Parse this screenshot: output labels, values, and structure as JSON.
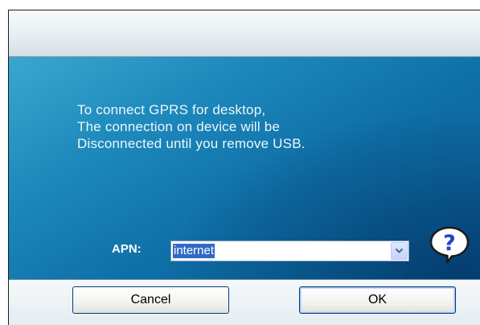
{
  "dialog": {
    "message_lines": [
      "To connect GPRS for desktop,",
      "The connection on device will be",
      "Disconnected until you remove USB."
    ],
    "apn": {
      "label": "APN:",
      "selected_value": "internet"
    },
    "help_icon": "help-question-icon",
    "buttons": {
      "cancel_label": "Cancel",
      "ok_label": "OK"
    }
  },
  "colors": {
    "content_background": "#1c88bb",
    "text": "#eef6fb",
    "selection_highlight": "#316ac5",
    "button_border": "#003c74"
  }
}
